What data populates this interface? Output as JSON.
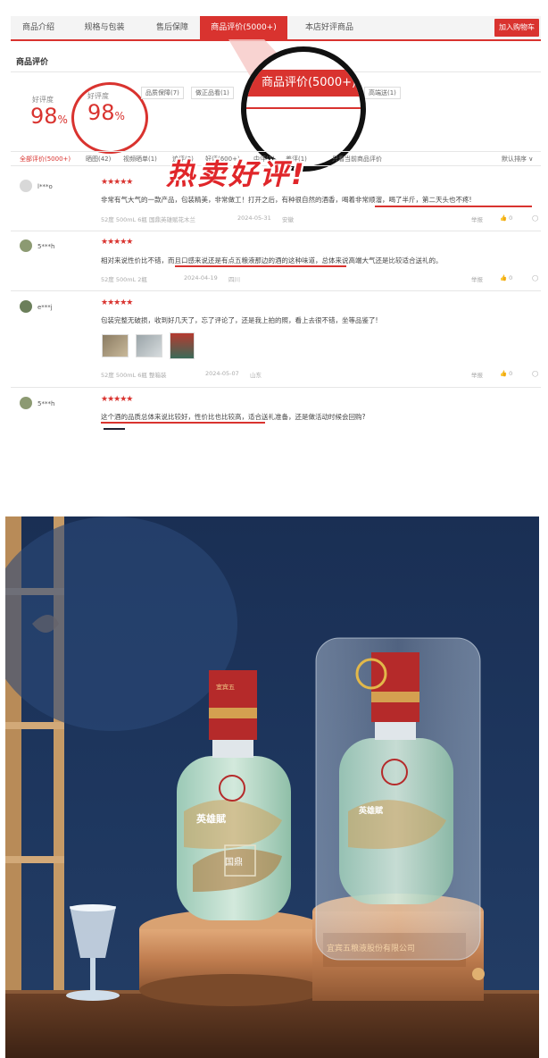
{
  "tabs": [
    {
      "label": "商品介绍"
    },
    {
      "label": "规格与包装"
    },
    {
      "label": "售后保障"
    },
    {
      "label": "商品评价(5000+)"
    },
    {
      "label": "本店好评商品"
    }
  ],
  "cart_button": "加入购物车",
  "section_title": "商品评价",
  "rating": {
    "label": "好评度",
    "value": "98",
    "unit": "%"
  },
  "tags": [
    "品质保障(7)",
    "做正品看(1)",
    "高端送(1)"
  ],
  "magnifier_label": "商品评价(5000+)",
  "headline": "热卖好评!",
  "filters": [
    "全部评价(5000+)",
    "晒图(42)",
    "视频晒单(1)",
    "追评(2)",
    "好评(600+)",
    "中评(1)",
    "差评(1)",
    "只看当前商品评价"
  ],
  "sort_label": "默认排序",
  "reviews": [
    {
      "user": "l***o",
      "text": "非常有气大气的一款产品，包装精美，非常做工！打开之后，有种很自然的酒香，",
      "highlight": "喝着非常顺溜，喝了半斤，第二天头也不疼!",
      "meta": "52度 500mL 6瓶 国鼎英雄赋花木兰",
      "date": "2024-05-31",
      "loc": "安徽",
      "report": "举报",
      "likes": "0"
    },
    {
      "user": "5***h",
      "text": "相对来说性价比不错，",
      "highlight": "而且口感来说还是有点五粮液那边的酒的这种味道，",
      "tail": "总体来说高端大气还是比较适合送礼的。",
      "meta": "52度 500mL 2瓶",
      "date": "2024-04-19",
      "loc": "四川",
      "report": "举报",
      "likes": "0"
    },
    {
      "user": "e***j",
      "text": "包装完整无破损，收到好几天了，忘了评论了，还是我上拍的照，看上去很不错，坐等品鉴了!",
      "meta": "52度 500mL 6瓶 整箱装",
      "date": "2024-05-07",
      "loc": "山东",
      "report": "举报",
      "likes": "0"
    },
    {
      "user": "5***h",
      "highlight": "这个酒的品质总体来说比较好，性价比也比较高，",
      "tail": "适合送礼准备，还是做活动时候会回购?"
    }
  ],
  "bottle_labels": {
    "brand": "英雄賦",
    "series": "国鼎",
    "base": "宜宾五粮液股份有限公司",
    "cap": "宜宾五"
  },
  "colors": {
    "accent": "#d9332f",
    "photo_bg": "#1e375f",
    "base_gold": "#c8895a"
  }
}
